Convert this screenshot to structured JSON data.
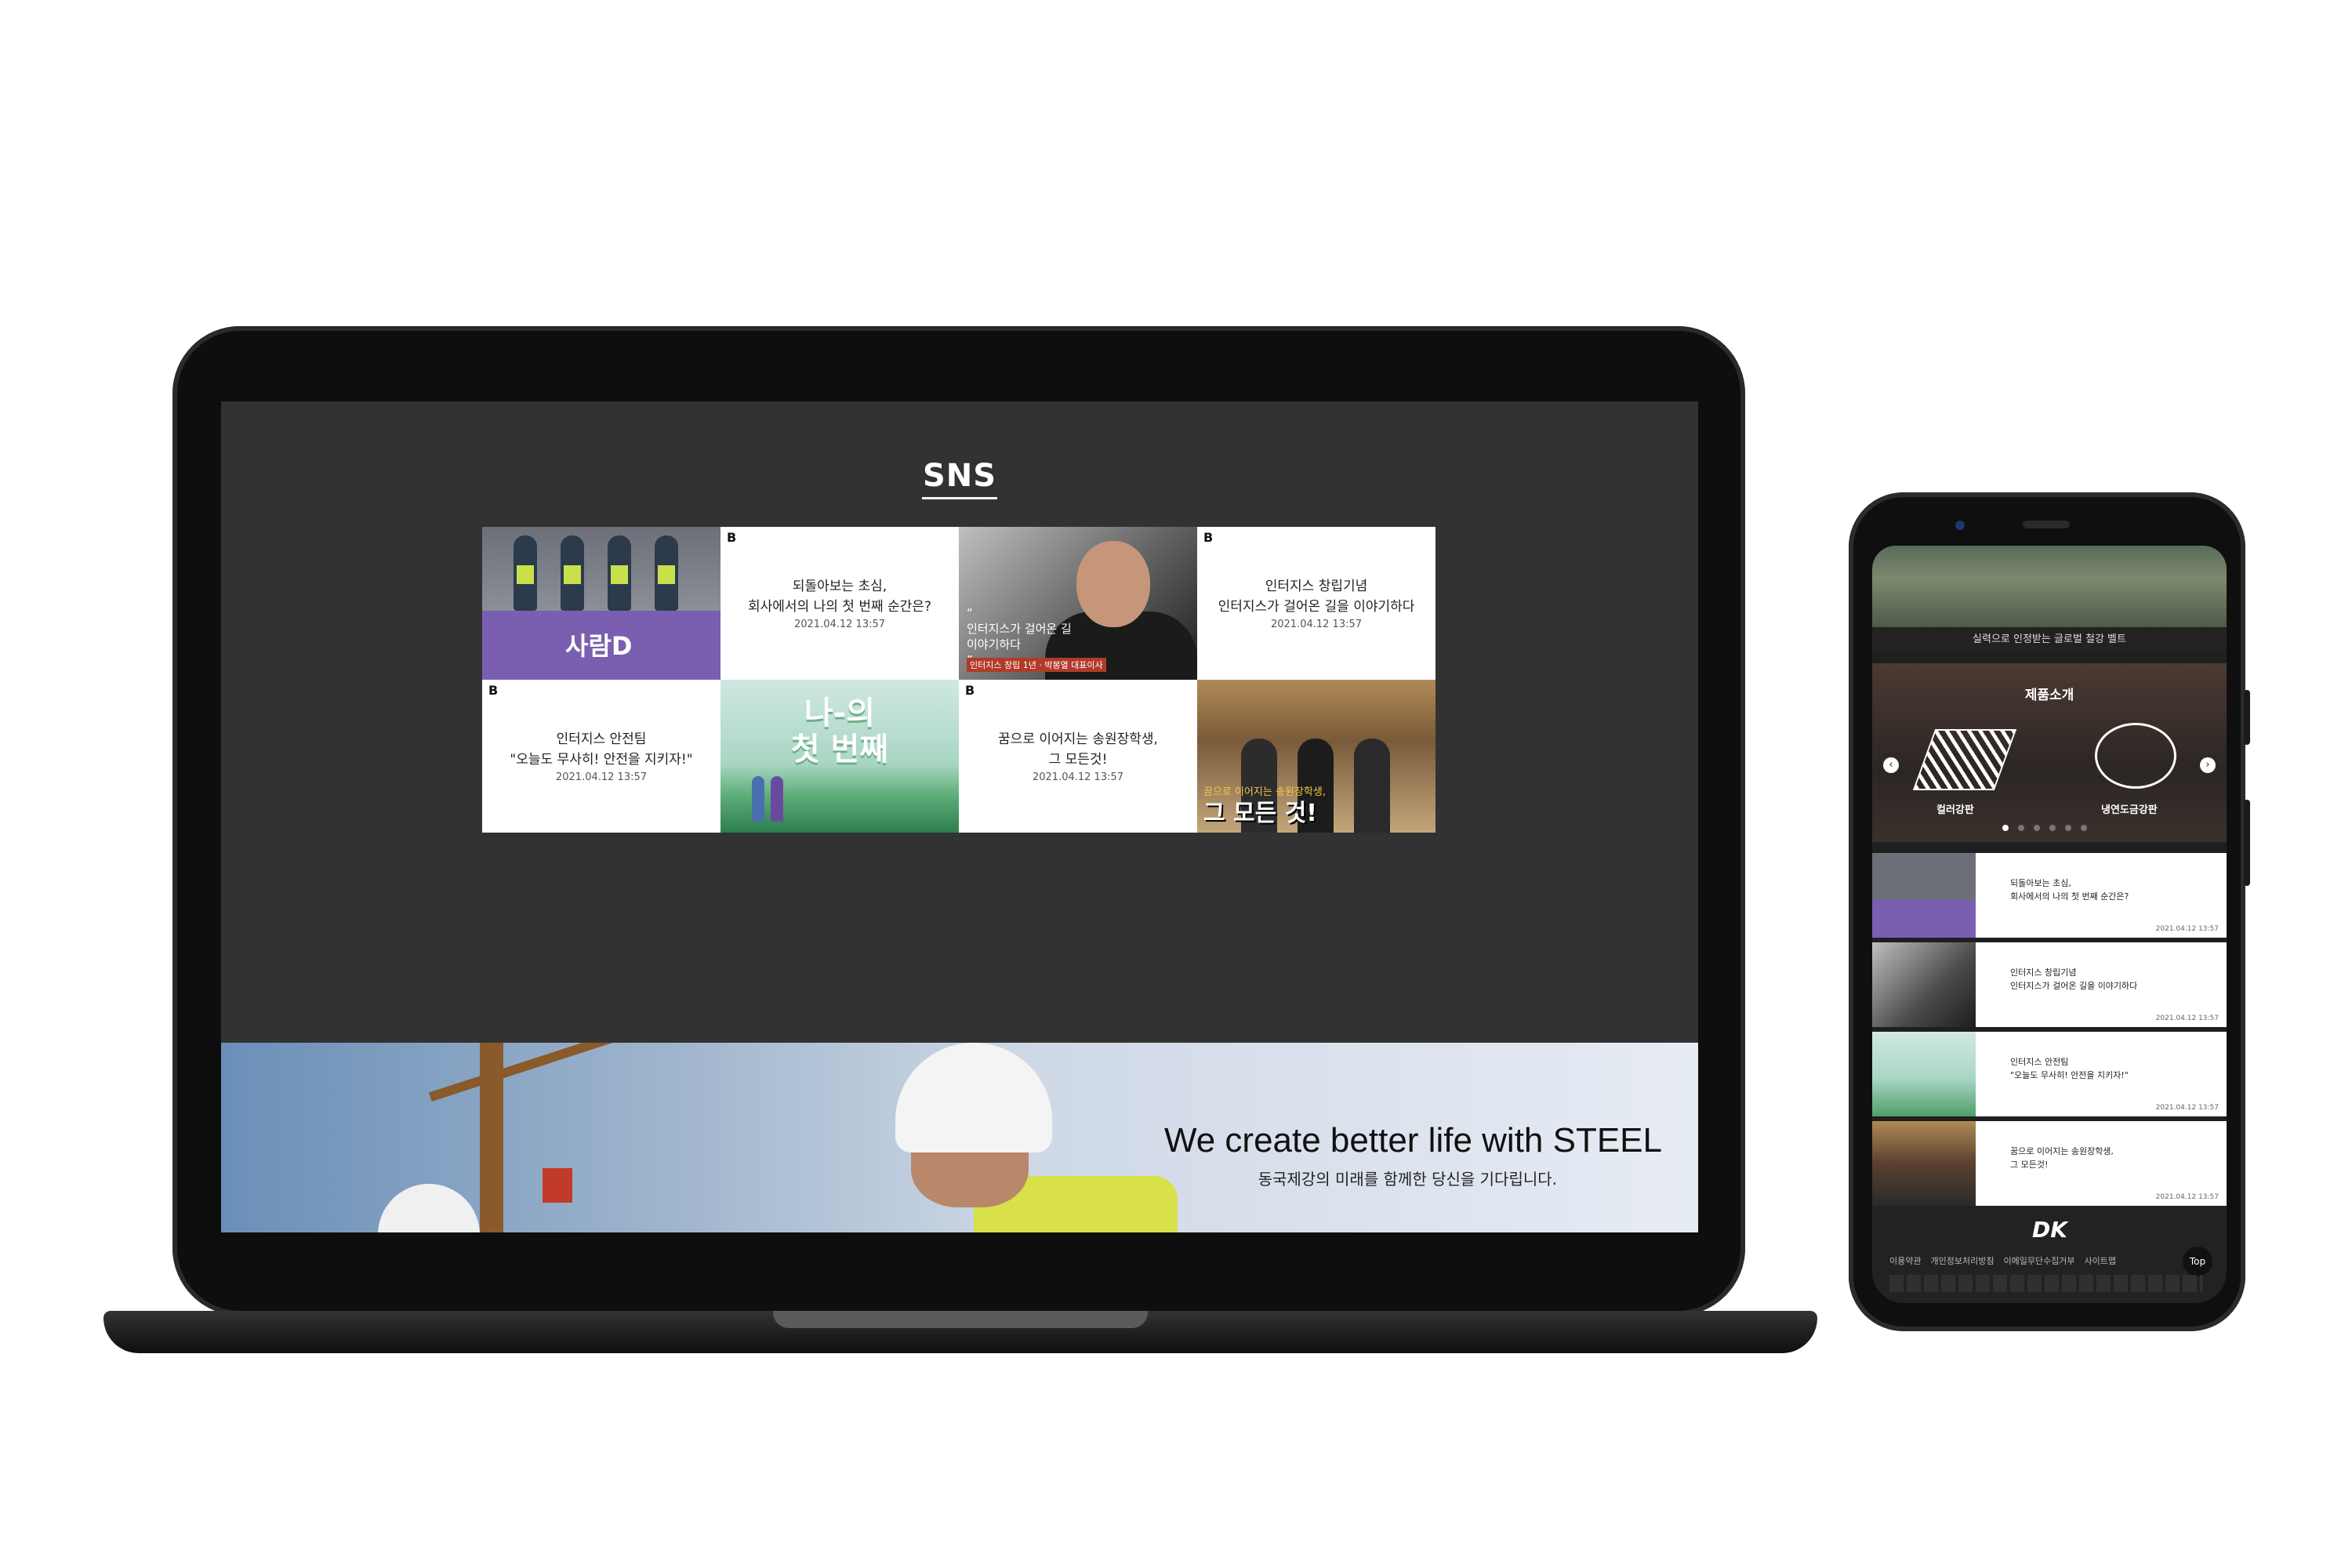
{
  "sns": {
    "title": "SNS",
    "tiles": [
      {
        "type": "image",
        "brand": "사람D"
      },
      {
        "badge": "B",
        "headline": "되돌아보는 초심,\n회사에서의 나의 첫 번째 순간은?",
        "date": "2021.04.12 13:57"
      },
      {
        "type": "image",
        "quote": "“\n인터지스가 걸어온 길\n이야기하다\n”",
        "caption": "인터지스 창립 1년 · 박봉열 대표이사"
      },
      {
        "badge": "B",
        "headline": "인터지스 창립기념\n인터지스가 걸어온 길을 이야기하다",
        "date": "2021.04.12 13:57"
      },
      {
        "badge": "B",
        "headline": "인터지스 안전팀\n\"오늘도 무사히! 안전을 지키자!\"",
        "date": "2021.04.12 13:57"
      },
      {
        "type": "image",
        "big": "나-의\n첫 번째"
      },
      {
        "badge": "B",
        "headline": "꿈으로 이어지는 송원장학생,\n그 모든것!",
        "date": "2021.04.12 13:57"
      },
      {
        "type": "image",
        "lead": "꿈으로 이어지는",
        "lead_highlight": "송원장학생,",
        "big": "그 모든 것!"
      }
    ]
  },
  "banner": {
    "title": "We create better life with STEEL",
    "subtitle": "동국제강의 미래를 함께한 당신을 기다립니다."
  },
  "mobile": {
    "hero_caption": "실력으로 인정받는 글로벌 철강 벨트",
    "products": {
      "title": "제품소개",
      "prev_icon": "chevron-left-icon",
      "next_icon": "chevron-right-icon",
      "items": [
        "컬러강판",
        "냉연도금강판"
      ],
      "dot_count": 6,
      "active_dot": 0
    },
    "cards": [
      {
        "text": "되돌아보는 초심,\n회사에서의 나의 첫 번째 순간은?",
        "date": "2021.04.12 13:57"
      },
      {
        "text": "인터지스 창립기념\n인터지스가 걸어온 길을 이야기하다",
        "date": "2021.04.12 13:57"
      },
      {
        "text": "인터지스 안전팀\n\"오늘도 무사히! 안전을 지키자!\"",
        "date": "2021.04.12 13:57"
      },
      {
        "text": "꿈으로 이어지는 송원장학생,\n그 모든것!",
        "date": "2021.04.12 13:57"
      }
    ],
    "footer": {
      "logo": "DK",
      "links": [
        "이용약관",
        "개인정보처리방침",
        "이메일무단수집거부",
        "사이트맵"
      ],
      "top_label": "Top"
    }
  }
}
